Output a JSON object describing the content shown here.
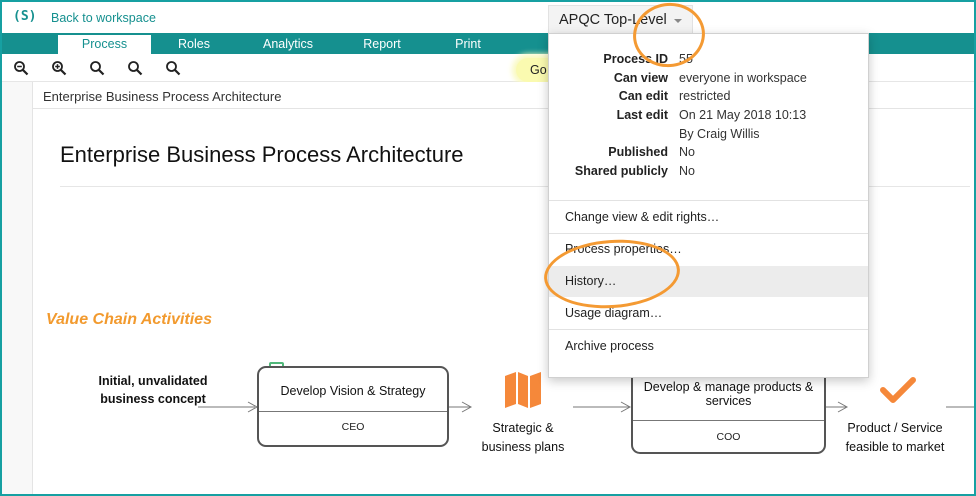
{
  "app": {
    "logo": "(S)",
    "back_link": "Back to workspace",
    "title": "APQC Top-Level"
  },
  "tabs": [
    {
      "label": "Process",
      "active": true
    },
    {
      "label": "Roles",
      "active": false
    },
    {
      "label": "Analytics",
      "active": false
    },
    {
      "label": "Report",
      "active": false
    },
    {
      "label": "Print",
      "active": false
    }
  ],
  "toolbar": {
    "zoom_icons": [
      "zoom-out-icon",
      "zoom-in-icon",
      "zoom-icon",
      "zoom-icon",
      "zoom-icon"
    ],
    "go_label": "Go"
  },
  "canvas": {
    "breadcrumb": "Enterprise Business Process Architecture",
    "title": "Enterprise Business Process Architecture",
    "section_label": "Value Chain Activities",
    "input_label": "Initial, unvalidated business concept",
    "processes": [
      {
        "name": "Develop Vision & Strategy",
        "role": "CEO"
      },
      {
        "name": "Develop & manage products & services",
        "role": "COO"
      }
    ],
    "outputs": [
      {
        "label": "Strategic & business plans",
        "icon": "map-icon"
      },
      {
        "label": "Product / Service feasible to market",
        "icon": "checkmark-icon"
      }
    ]
  },
  "popup": {
    "details": [
      {
        "key": "Process ID",
        "value": "55"
      },
      {
        "key": "Can view",
        "value": "everyone in workspace"
      },
      {
        "key": "Can edit",
        "value": "restricted"
      },
      {
        "key": "Last edit",
        "value": "On 21 May 2018 10:13"
      },
      {
        "key": "",
        "value": "By Craig Willis"
      },
      {
        "key": "Published",
        "value": "No"
      },
      {
        "key": "Shared publicly",
        "value": "No"
      }
    ],
    "menu": [
      "Change view & edit rights…",
      "Process properties…",
      "History…",
      "Usage diagram…",
      "Archive process"
    ]
  },
  "colors": {
    "brand_teal": "#15908f",
    "annotation_orange": "#f49a33",
    "section_orange": "#f29a2e",
    "marker_green": "#50b87a"
  }
}
